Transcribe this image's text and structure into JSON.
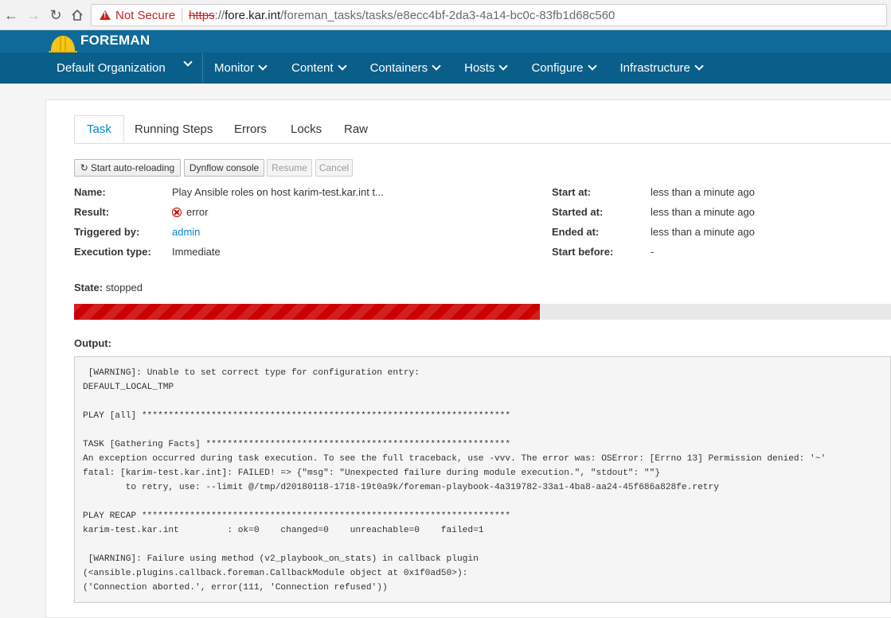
{
  "browser": {
    "security_label": "Not Secure",
    "url_scheme": "https",
    "url_separator": "://",
    "url_host": "fore.kar.int",
    "url_path": "/foreman_tasks/tasks/e8ecc4bf-2da3-4a14-bc0c-83fb1d68c560"
  },
  "header": {
    "brand": "FOREMAN",
    "organization": "Default Organization",
    "nav_items": [
      "Monitor",
      "Content",
      "Containers",
      "Hosts",
      "Configure",
      "Infrastructure"
    ]
  },
  "tabs": [
    "Task",
    "Running Steps",
    "Errors",
    "Locks",
    "Raw"
  ],
  "active_tab": "Task",
  "actions": {
    "auto_reload": "Start auto-reloading",
    "dynflow": "Dynflow console",
    "resume": "Resume",
    "cancel": "Cancel"
  },
  "details_left": {
    "name_label": "Name:",
    "name_value": "Play Ansible roles on host karim-test.kar.int t...",
    "result_label": "Result:",
    "result_value": "error",
    "triggered_label": "Triggered by:",
    "triggered_value": "admin",
    "exec_label": "Execution type:",
    "exec_value": "Immediate"
  },
  "details_right": {
    "start_at_label": "Start at:",
    "start_at_value": "less than a minute ago",
    "started_at_label": "Started at:",
    "started_at_value": "less than a minute ago",
    "ended_at_label": "Ended at:",
    "ended_at_value": "less than a minute ago",
    "start_before_label": "Start before:",
    "start_before_value": "-"
  },
  "state": {
    "label": "State:",
    "value": "stopped",
    "progress_fraction": 0.57,
    "progress_color": "#cc0000"
  },
  "output": {
    "label": "Output:",
    "text": " [WARNING]: Unable to set correct type for configuration entry:\nDEFAULT_LOCAL_TMP\n\nPLAY [all] *********************************************************************\n\nTASK [Gathering Facts] *********************************************************\nAn exception occurred during task execution. To see the full traceback, use -vvv. The error was: OSError: [Errno 13] Permission denied: '~'\nfatal: [karim-test.kar.int]: FAILED! => {\"msg\": \"Unexpected failure during module execution.\", \"stdout\": \"\"}\n        to retry, use: --limit @/tmp/d20180118-1718-19t0a9k/foreman-playbook-4a319782-33a1-4ba8-aa24-45f686a828fe.retry\n\nPLAY RECAP *********************************************************************\nkarim-test.kar.int         : ok=0    changed=0    unreachable=0    failed=1\n\n [WARNING]: Failure using method (v2_playbook_on_stats) in callback plugin\n(<ansible.plugins.callback.foreman.CallbackModule object at 0x1f0ad50>):\n('Connection aborted.', error(111, 'Connection refused'))"
  },
  "colors": {
    "brand_bar": "#0f6a99",
    "nav_bar": "#0a5e8a",
    "link": "#0088ce",
    "error": "#cc0000"
  }
}
